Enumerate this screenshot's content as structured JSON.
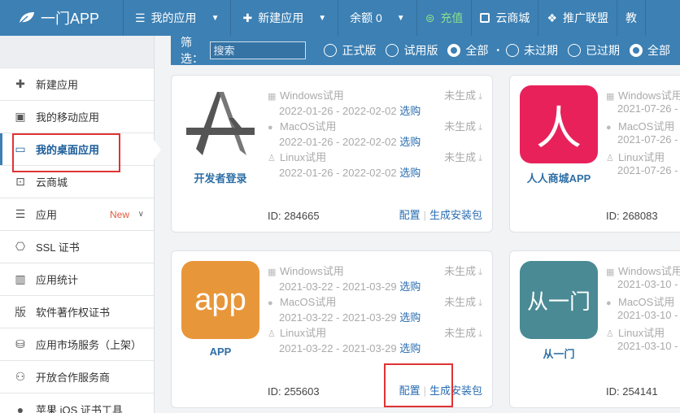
{
  "topbar": {
    "brand": "一门APP",
    "nav": [
      {
        "label": "我的应用",
        "icon": "list-icon",
        "dropdown": true
      },
      {
        "label": "新建应用",
        "icon": "plus-icon",
        "dropdown": true
      },
      {
        "label": "余额 0",
        "icon": "",
        "dropdown": true
      },
      {
        "label": "充值",
        "icon": "yen-icon",
        "dropdown": false
      },
      {
        "label": "云商城",
        "icon": "bag-icon",
        "dropdown": false
      },
      {
        "label": "推广联盟",
        "icon": "diamond-icon",
        "dropdown": false
      },
      {
        "label": "教",
        "icon": "",
        "dropdown": false
      }
    ]
  },
  "sidebar": {
    "items": [
      {
        "label": "新建应用",
        "icon": "plus-icon"
      },
      {
        "label": "我的移动应用",
        "icon": "phone-icon"
      },
      {
        "label": "我的桌面应用",
        "icon": "monitor-icon",
        "active": true
      },
      {
        "label": "云商城",
        "icon": "bag-icon"
      },
      {
        "label": "应用",
        "icon": "menu-icon",
        "badge": "New"
      },
      {
        "label": "SSL 证书",
        "icon": "ssl-icon"
      },
      {
        "label": "应用统计",
        "icon": "bar-chart-icon"
      },
      {
        "label": "软件著作权证书",
        "icon": "copyright-icon"
      },
      {
        "label": "应用市场服务（上架）",
        "icon": "market-icon"
      },
      {
        "label": "开放合作服务商",
        "icon": "partner-icon"
      },
      {
        "label": "苹果 iOS 证书工具",
        "icon": "apple-icon"
      }
    ]
  },
  "filter": {
    "label": "筛选：",
    "search_placeholder": "搜索",
    "options": [
      "正式版",
      "试用版",
      "全部",
      "未过期",
      "已过期",
      "全部"
    ]
  },
  "cards": [
    {
      "name": "开发者登录",
      "id": "ID: 284665",
      "platforms": [
        {
          "name": "Windows试用",
          "dates": "2022-01-26 - 2022-02-02",
          "status": "未生成"
        },
        {
          "name": "MacOS试用",
          "dates": "2022-01-26 - 2022-02-02",
          "status": "未生成"
        },
        {
          "name": "Linux试用",
          "dates": "2022-01-26 - 2022-02-02",
          "status": "未生成"
        }
      ]
    },
    {
      "name": "人人商城APP",
      "id": "ID: 268083",
      "icon_text": "人",
      "icon_color": "#e8215a",
      "platforms": [
        {
          "name": "Windows试用",
          "dates": "2021-07-26 -",
          "status": ""
        },
        {
          "name": "MacOS试用",
          "dates": "2021-07-26 -",
          "status": ""
        },
        {
          "name": "Linux试用",
          "dates": "2021-07-26 -",
          "status": ""
        }
      ]
    },
    {
      "name": "APP",
      "id": "ID: 255603",
      "icon_text": "app",
      "icon_color": "#e8963a",
      "platforms": [
        {
          "name": "Windows试用",
          "dates": "2021-03-22 - 2021-03-29",
          "status": "未生成"
        },
        {
          "name": "MacOS试用",
          "dates": "2021-03-22 - 2021-03-29",
          "status": "未生成"
        },
        {
          "name": "Linux试用",
          "dates": "2021-03-22 - 2021-03-29",
          "status": "未生成"
        }
      ]
    },
    {
      "name": "从一门",
      "id": "ID: 254141",
      "icon_text": "从一门",
      "icon_color": "#4a8a94",
      "platforms": [
        {
          "name": "Windows试用",
          "dates": "2021-03-10 -",
          "status": ""
        },
        {
          "name": "MacOS试用",
          "dates": "2021-03-10 -",
          "status": ""
        },
        {
          "name": "Linux试用",
          "dates": "2021-03-10 -",
          "status": ""
        }
      ]
    }
  ],
  "card_ui": {
    "select_label": "选购",
    "config_label": "配置",
    "build_label": "生成安装包",
    "separator": "|"
  }
}
